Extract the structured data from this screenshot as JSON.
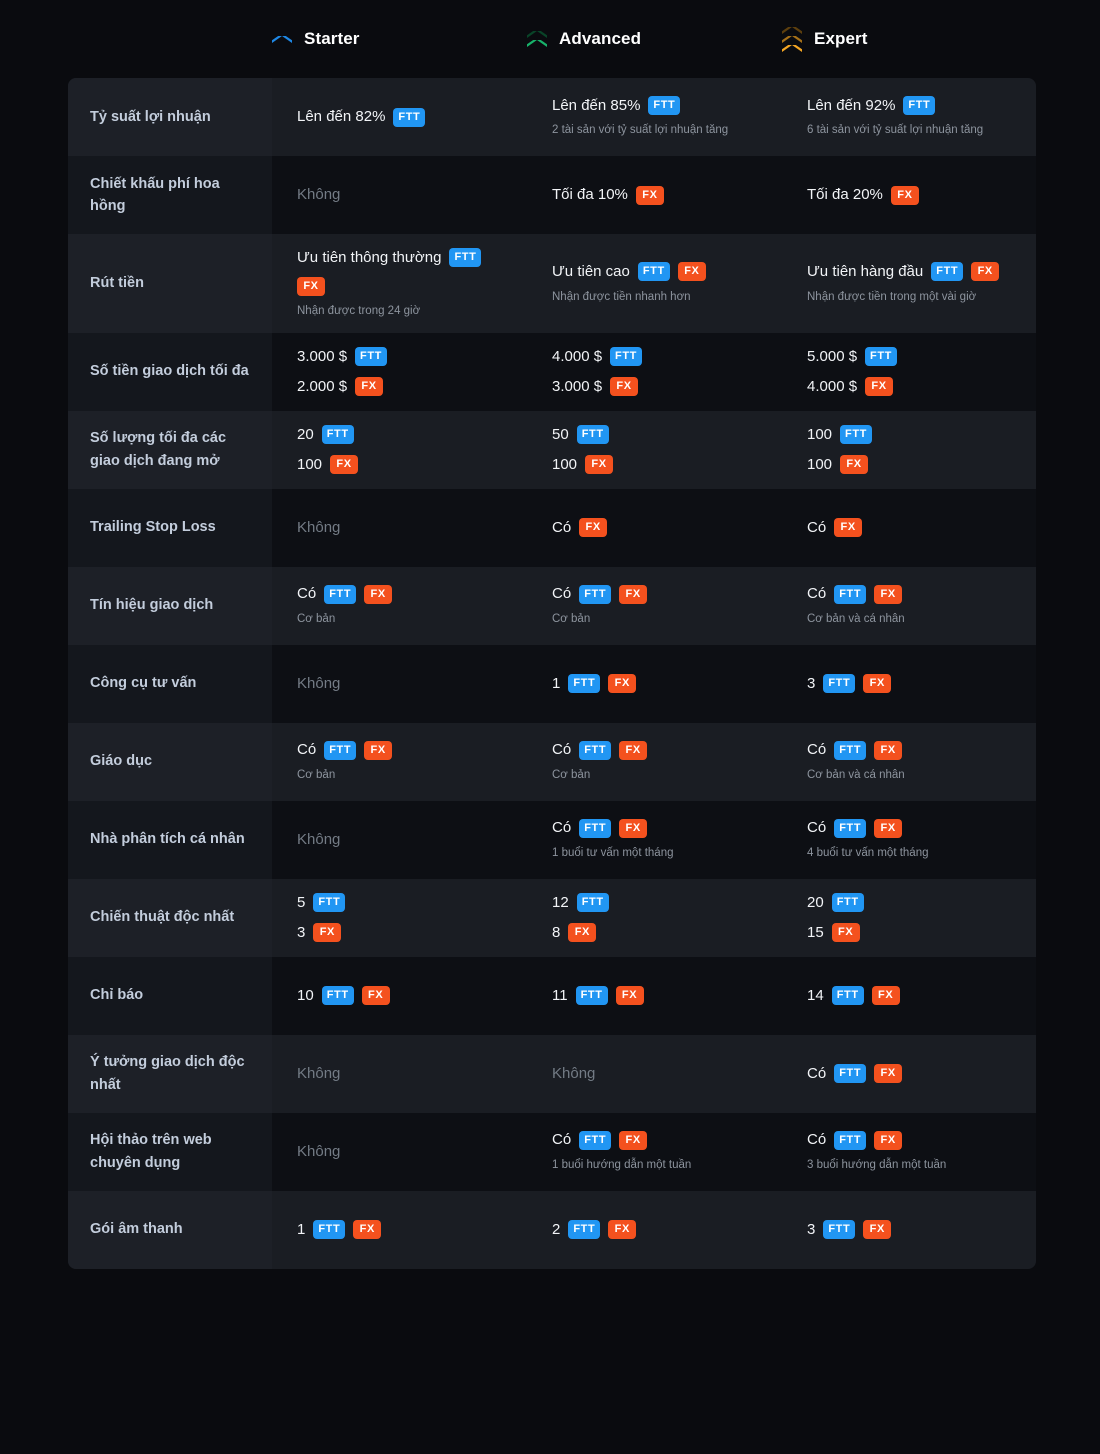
{
  "colors": {
    "page_bg": "#0a0b0f",
    "row_odd": "#1a1d23",
    "row_even": "#0d0f14",
    "badge_ftt": "#2196f3",
    "badge_fx": "#f4511e",
    "label_text": "#c3cddc",
    "muted_text": "#737b85",
    "chevron_starter": "#1e88e5",
    "chevron_advanced": "#18b26a",
    "chevron_expert": "#f5a623"
  },
  "header": {
    "columns": [
      {
        "label": "Starter",
        "icon": "chevron-single-blue-icon",
        "chevrons": 1,
        "color": "#1e88e5"
      },
      {
        "label": "Advanced",
        "icon": "chevron-double-green-icon",
        "chevrons": 2,
        "color": "#18b26a"
      },
      {
        "label": "Expert",
        "icon": "chevron-triple-gold-icon",
        "chevrons": 3,
        "color": "#f5a623"
      }
    ]
  },
  "rows": [
    {
      "label": "Tỷ suất lợi nhuận",
      "cells": [
        {
          "lines": [
            {
              "text": "Lên đến 82%",
              "badges": [
                "FTT"
              ]
            }
          ],
          "note": ""
        },
        {
          "lines": [
            {
              "text": "Lên đến 85%",
              "badges": [
                "FTT"
              ]
            }
          ],
          "note": "2 tài sản với tỷ suất lợi nhuận tăng"
        },
        {
          "lines": [
            {
              "text": "Lên đến 92%",
              "badges": [
                "FTT"
              ]
            }
          ],
          "note": "6 tài sản với tỷ suất lợi nhuận tăng"
        }
      ]
    },
    {
      "label": "Chiết khấu phí hoa hồng",
      "cells": [
        {
          "lines": [
            {
              "text": "Không",
              "muted": true,
              "badges": []
            }
          ],
          "note": ""
        },
        {
          "lines": [
            {
              "text": "Tối đa 10%",
              "badges": [
                "FX"
              ]
            }
          ],
          "note": ""
        },
        {
          "lines": [
            {
              "text": "Tối đa 20%",
              "badges": [
                "FX"
              ]
            }
          ],
          "note": ""
        }
      ]
    },
    {
      "label": "Rút tiền",
      "cells": [
        {
          "lines": [
            {
              "text": "Ưu tiên thông thường",
              "badges": [
                "FTT",
                "FX"
              ]
            }
          ],
          "note": "Nhận được trong 24 giờ"
        },
        {
          "lines": [
            {
              "text": "Ưu tiên cao",
              "badges": [
                "FTT",
                "FX"
              ]
            }
          ],
          "note": "Nhận được tiền nhanh hơn"
        },
        {
          "lines": [
            {
              "text": "Ưu tiên hàng đầu",
              "badges": [
                "FTT",
                "FX"
              ]
            }
          ],
          "note": "Nhận được tiền trong một vài giờ"
        }
      ]
    },
    {
      "label": "Số tiền giao dịch tối đa",
      "cells": [
        {
          "lines": [
            {
              "text": "3.000 $",
              "badges": [
                "FTT"
              ]
            },
            {
              "text": "2.000 $",
              "badges": [
                "FX"
              ]
            }
          ],
          "note": ""
        },
        {
          "lines": [
            {
              "text": "4.000 $",
              "badges": [
                "FTT"
              ]
            },
            {
              "text": "3.000 $",
              "badges": [
                "FX"
              ]
            }
          ],
          "note": ""
        },
        {
          "lines": [
            {
              "text": "5.000 $",
              "badges": [
                "FTT"
              ]
            },
            {
              "text": "4.000 $",
              "badges": [
                "FX"
              ]
            }
          ],
          "note": ""
        }
      ]
    },
    {
      "label": "Số lượng tối đa các giao dịch đang mở",
      "cells": [
        {
          "lines": [
            {
              "text": "20",
              "badges": [
                "FTT"
              ]
            },
            {
              "text": "100",
              "badges": [
                "FX"
              ]
            }
          ],
          "note": ""
        },
        {
          "lines": [
            {
              "text": "50",
              "badges": [
                "FTT"
              ]
            },
            {
              "text": "100",
              "badges": [
                "FX"
              ]
            }
          ],
          "note": ""
        },
        {
          "lines": [
            {
              "text": "100",
              "badges": [
                "FTT"
              ]
            },
            {
              "text": "100",
              "badges": [
                "FX"
              ]
            }
          ],
          "note": ""
        }
      ]
    },
    {
      "label": "Trailing Stop Loss",
      "cells": [
        {
          "lines": [
            {
              "text": "Không",
              "muted": true,
              "badges": []
            }
          ],
          "note": ""
        },
        {
          "lines": [
            {
              "text": "Có",
              "badges": [
                "FX"
              ]
            }
          ],
          "note": ""
        },
        {
          "lines": [
            {
              "text": "Có",
              "badges": [
                "FX"
              ]
            }
          ],
          "note": ""
        }
      ]
    },
    {
      "label": "Tín hiệu giao dịch",
      "cells": [
        {
          "lines": [
            {
              "text": "Có",
              "badges": [
                "FTT",
                "FX"
              ]
            }
          ],
          "note": "Cơ bản"
        },
        {
          "lines": [
            {
              "text": "Có",
              "badges": [
                "FTT",
                "FX"
              ]
            }
          ],
          "note": "Cơ bản"
        },
        {
          "lines": [
            {
              "text": "Có",
              "badges": [
                "FTT",
                "FX"
              ]
            }
          ],
          "note": "Cơ bản và cá nhân"
        }
      ]
    },
    {
      "label": "Công cụ tư vấn",
      "cells": [
        {
          "lines": [
            {
              "text": "Không",
              "muted": true,
              "badges": []
            }
          ],
          "note": ""
        },
        {
          "lines": [
            {
              "text": "1",
              "badges": [
                "FTT",
                "FX"
              ]
            }
          ],
          "note": ""
        },
        {
          "lines": [
            {
              "text": "3",
              "badges": [
                "FTT",
                "FX"
              ]
            }
          ],
          "note": ""
        }
      ]
    },
    {
      "label": "Giáo dục",
      "cells": [
        {
          "lines": [
            {
              "text": "Có",
              "badges": [
                "FTT",
                "FX"
              ]
            }
          ],
          "note": "Cơ bản"
        },
        {
          "lines": [
            {
              "text": "Có",
              "badges": [
                "FTT",
                "FX"
              ]
            }
          ],
          "note": "Cơ bản"
        },
        {
          "lines": [
            {
              "text": "Có",
              "badges": [
                "FTT",
                "FX"
              ]
            }
          ],
          "note": "Cơ bản và cá nhân"
        }
      ]
    },
    {
      "label": "Nhà phân tích cá nhân",
      "cells": [
        {
          "lines": [
            {
              "text": "Không",
              "muted": true,
              "badges": []
            }
          ],
          "note": ""
        },
        {
          "lines": [
            {
              "text": "Có",
              "badges": [
                "FTT",
                "FX"
              ]
            }
          ],
          "note": "1 buổi tư vấn một tháng"
        },
        {
          "lines": [
            {
              "text": "Có",
              "badges": [
                "FTT",
                "FX"
              ]
            }
          ],
          "note": "4 buổi tư vấn một tháng"
        }
      ]
    },
    {
      "label": "Chiến thuật độc nhất",
      "cells": [
        {
          "lines": [
            {
              "text": "5",
              "badges": [
                "FTT"
              ]
            },
            {
              "text": "3",
              "badges": [
                "FX"
              ]
            }
          ],
          "note": ""
        },
        {
          "lines": [
            {
              "text": "12",
              "badges": [
                "FTT"
              ]
            },
            {
              "text": "8",
              "badges": [
                "FX"
              ]
            }
          ],
          "note": ""
        },
        {
          "lines": [
            {
              "text": "20",
              "badges": [
                "FTT"
              ]
            },
            {
              "text": "15",
              "badges": [
                "FX"
              ]
            }
          ],
          "note": ""
        }
      ]
    },
    {
      "label": "Chỉ báo",
      "cells": [
        {
          "lines": [
            {
              "text": "10",
              "badges": [
                "FTT",
                "FX"
              ]
            }
          ],
          "note": ""
        },
        {
          "lines": [
            {
              "text": "11",
              "badges": [
                "FTT",
                "FX"
              ]
            }
          ],
          "note": ""
        },
        {
          "lines": [
            {
              "text": "14",
              "badges": [
                "FTT",
                "FX"
              ]
            }
          ],
          "note": ""
        }
      ]
    },
    {
      "label": "Ý tưởng giao dịch độc nhất",
      "cells": [
        {
          "lines": [
            {
              "text": "Không",
              "muted": true,
              "badges": []
            }
          ],
          "note": ""
        },
        {
          "lines": [
            {
              "text": "Không",
              "muted": true,
              "badges": []
            }
          ],
          "note": ""
        },
        {
          "lines": [
            {
              "text": "Có",
              "badges": [
                "FTT",
                "FX"
              ]
            }
          ],
          "note": ""
        }
      ]
    },
    {
      "label": "Hội thảo trên web chuyên dụng",
      "cells": [
        {
          "lines": [
            {
              "text": "Không",
              "muted": true,
              "badges": []
            }
          ],
          "note": ""
        },
        {
          "lines": [
            {
              "text": "Có",
              "badges": [
                "FTT",
                "FX"
              ]
            }
          ],
          "note": "1 buổi hướng dẫn một tuần"
        },
        {
          "lines": [
            {
              "text": "Có",
              "badges": [
                "FTT",
                "FX"
              ]
            }
          ],
          "note": "3 buổi hướng dẫn một tuần"
        }
      ]
    },
    {
      "label": "Gói âm thanh",
      "cells": [
        {
          "lines": [
            {
              "text": "1",
              "badges": [
                "FTT",
                "FX"
              ]
            }
          ],
          "note": ""
        },
        {
          "lines": [
            {
              "text": "2",
              "badges": [
                "FTT",
                "FX"
              ]
            }
          ],
          "note": ""
        },
        {
          "lines": [
            {
              "text": "3",
              "badges": [
                "FTT",
                "FX"
              ]
            }
          ],
          "note": ""
        }
      ]
    }
  ]
}
